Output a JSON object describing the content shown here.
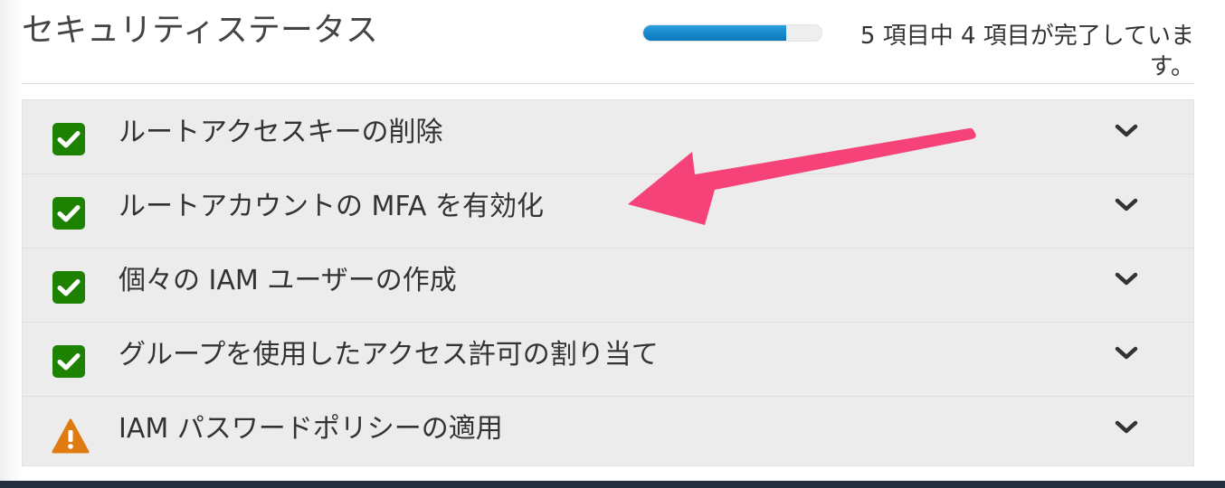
{
  "security_status": {
    "title": "セキュリティステータス",
    "progress": {
      "completed": 4,
      "total": 5,
      "text": "5 項目中 4 項目が完了しています。"
    },
    "items": [
      {
        "label": "ルートアクセスキーの削除",
        "status": "complete",
        "icon": "check-icon"
      },
      {
        "label": "ルートアカウントの MFA を有効化",
        "status": "complete",
        "icon": "check-icon"
      },
      {
        "label": "個々の IAM ユーザーの作成",
        "status": "complete",
        "icon": "check-icon"
      },
      {
        "label": "グループを使用したアクセス許可の割り当て",
        "status": "complete",
        "icon": "check-icon"
      },
      {
        "label": "IAM パスワードポリシーの適用",
        "status": "warning",
        "icon": "warning-icon"
      }
    ]
  },
  "colors": {
    "progress_fill": "#0a77bd",
    "check_green": "#1d8102",
    "warning_orange": "#e07b12",
    "annotation_arrow": "#f5437a",
    "bottom_bar": "#232f3e"
  }
}
